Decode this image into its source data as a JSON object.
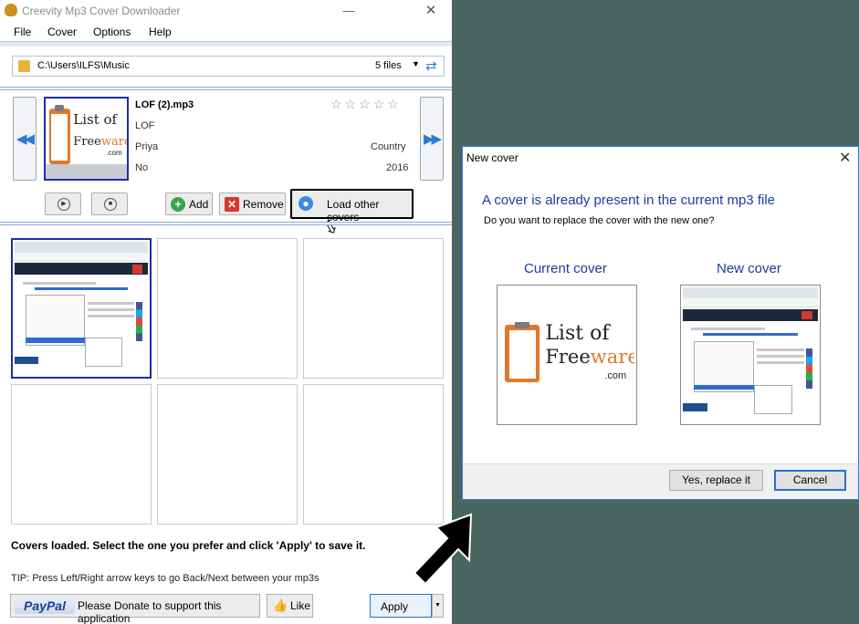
{
  "window": {
    "title": "Creevity Mp3 Cover Downloader",
    "minimize": "—",
    "close": "✕"
  },
  "menu": {
    "file": "File",
    "cover": "Cover",
    "options": "Options",
    "help": "Help"
  },
  "path": {
    "folder": "C:\\Users\\ILFS\\Music",
    "files": "5 files",
    "dropdown": "▼",
    "refresh": "⇄"
  },
  "track": {
    "filename": "LOF (2).mp3",
    "artist": "LOF",
    "album": "Priya",
    "genre": "Country",
    "extra": "No",
    "year": "2016",
    "rating_stars": 0,
    "stars": "☆☆☆☆☆"
  },
  "nav": {
    "prev": "◀◀",
    "next": "▶▶"
  },
  "buttons": {
    "play_icon": "▶",
    "stop_icon": "■",
    "add": "Add",
    "add_icon": "+",
    "remove": "Remove",
    "remove_icon": "✕",
    "load_other": "Load other covers",
    "load_icon": "●"
  },
  "logo": {
    "line1": "List of",
    "line2a": "Free",
    "line2b": "ware",
    "line3": ".com"
  },
  "status": "Covers loaded. Select the one you prefer and click 'Apply' to save it.",
  "tip": "TIP: Press Left/Right arrow keys to go Back/Next between your mp3s",
  "footer": {
    "paypal": "PayPal",
    "donate": "Please Donate to support this application",
    "like": "Like",
    "like_icon": "👍",
    "apply": "Apply",
    "apply_dd": "▼"
  },
  "dialog": {
    "title": "New cover",
    "close": "✕",
    "heading": "A cover is already present in the current mp3 file",
    "question": "Do you want to replace the cover with the new one?",
    "current_label": "Current cover",
    "new_label": "New cover",
    "yes": "Yes, replace it",
    "cancel": "Cancel"
  },
  "colors": {
    "accent": "#1a2fa8",
    "dialog_heading": "#1a3ca0",
    "desktop": "#4a6660"
  }
}
